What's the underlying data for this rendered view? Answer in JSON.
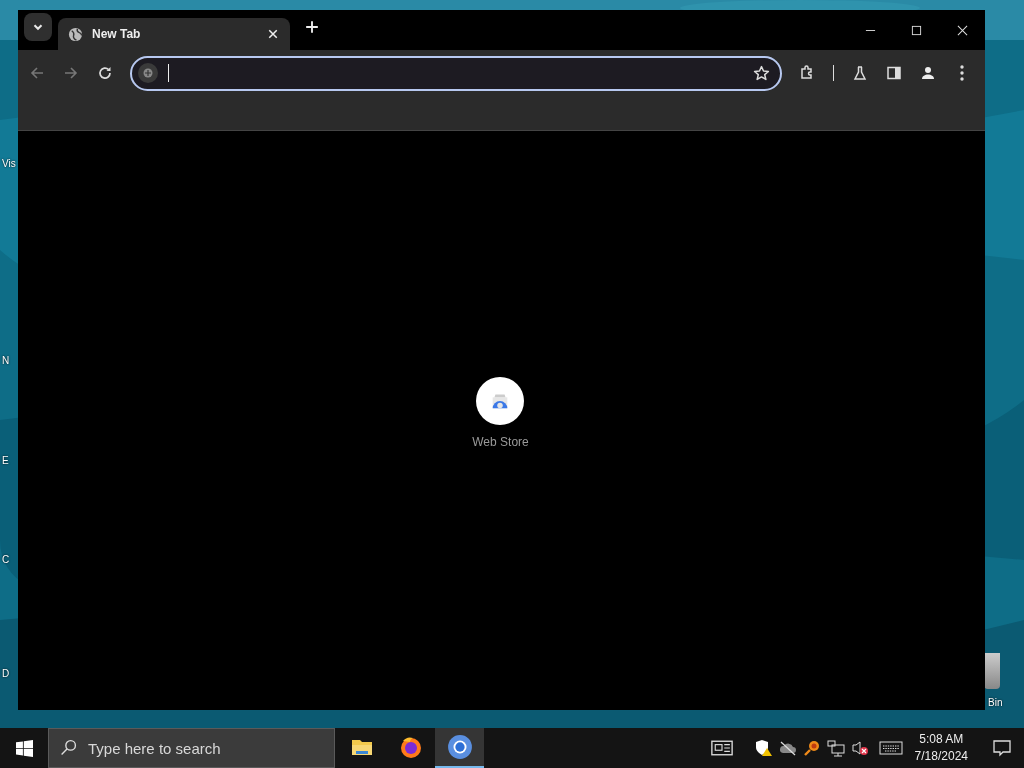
{
  "desktop": {
    "icons": [
      {
        "label": "Vis"
      },
      {
        "label": "N"
      },
      {
        "label": "E"
      },
      {
        "label": "C"
      },
      {
        "label": "D"
      },
      {
        "label": "Bin"
      }
    ]
  },
  "browser": {
    "tabs": [
      {
        "title": "New Tab",
        "selected": true
      }
    ],
    "new_tab_page": {
      "shortcuts": [
        {
          "label": "Web Store"
        }
      ]
    }
  },
  "taskbar": {
    "search": {
      "placeholder": "Type here to search"
    },
    "apps": [
      {
        "kind": "folder",
        "active": false
      },
      {
        "kind": "firefox",
        "active": false
      },
      {
        "kind": "chrome",
        "active": true
      }
    ],
    "clock": {
      "time": "5:08 AM",
      "date": "7/18/2024"
    }
  }
}
